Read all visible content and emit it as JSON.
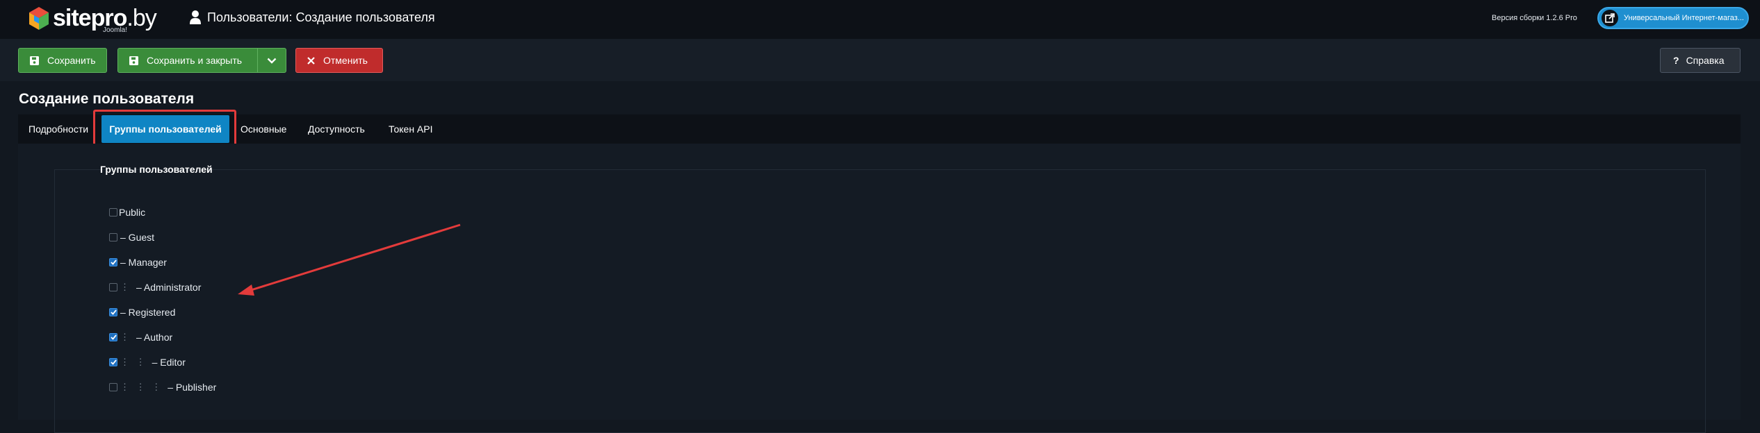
{
  "header": {
    "logo_text_bold": "site",
    "logo_text_pro": "pro",
    "logo_text_domain": ".by",
    "logo_sub": "Joomla!",
    "title": "Пользователи: Создание пользователя",
    "version": "Версия сборки 1.2.6 Pro",
    "store_button": "Универсальный Интернет-магаз..."
  },
  "toolbar": {
    "save": "Сохранить",
    "save_close": "Сохранить и закрыть",
    "cancel": "Отменить",
    "help": "Справка"
  },
  "page": {
    "heading": "Создание пользователя"
  },
  "tabs": [
    {
      "label": "Подробности",
      "active": false
    },
    {
      "label": "Группы пользователей",
      "active": true
    },
    {
      "label": "Основные",
      "active": false
    },
    {
      "label": "Доступность",
      "active": false
    },
    {
      "label": "Токен API",
      "active": false
    }
  ],
  "groups": {
    "legend": "Группы пользователей",
    "items": [
      {
        "label": "Public",
        "prefix": "",
        "checked": false
      },
      {
        "label": "– Guest",
        "prefix": "",
        "checked": false
      },
      {
        "label": "– Manager",
        "prefix": "",
        "checked": true
      },
      {
        "label": "– Administrator",
        "prefix": "⋮",
        "checked": false
      },
      {
        "label": "– Registered",
        "prefix": "",
        "checked": true
      },
      {
        "label": "– Author",
        "prefix": "⋮",
        "checked": true
      },
      {
        "label": "– Editor",
        "prefix": "⋮ ⋮",
        "checked": true
      },
      {
        "label": "– Publisher",
        "prefix": "⋮ ⋮ ⋮",
        "checked": false
      }
    ]
  },
  "colors": {
    "accent": "#0f85c4",
    "highlight": "#e33b3b",
    "save_green": "#3a8c3a",
    "cancel_red": "#c02c2c"
  }
}
